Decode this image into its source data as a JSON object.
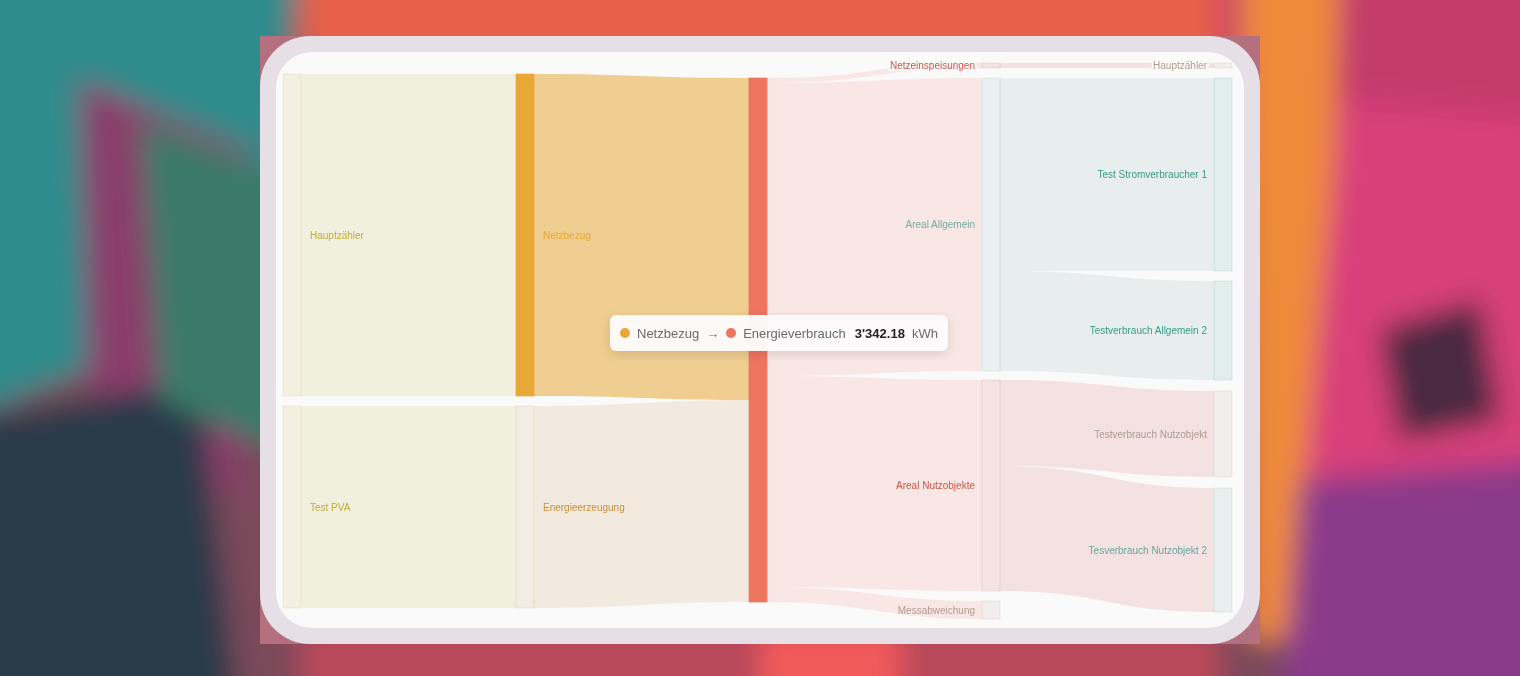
{
  "sankey": {
    "columns": [
      {
        "nodes": [
          {
            "label": "Hauptzähler",
            "color": "#c2ae3c",
            "highlighted": false
          },
          {
            "label": "Test PVA",
            "color": "#c2ae3c",
            "highlighted": false
          }
        ]
      },
      {
        "nodes": [
          {
            "label": "Netzbezug",
            "color": "#e8a838",
            "highlighted": true
          },
          {
            "label": "Energieerzeugung",
            "color": "#c98f36",
            "highlighted": false
          }
        ]
      },
      {
        "nodes": [
          {
            "color": "#f07560",
            "highlighted": true
          }
        ]
      },
      {
        "nodes": [
          {
            "label": "Netzeinspeisungen",
            "color": "#cc564b",
            "highlighted": false
          },
          {
            "label": "Areal Allgemein",
            "color": "#78aaa2",
            "highlighted": false
          },
          {
            "label": "Areal Nutzobjekte",
            "color": "#cc564b",
            "highlighted": false
          },
          {
            "label": "Messabweichung",
            "color": "#b39b90",
            "highlighted": false
          }
        ]
      },
      {
        "nodes": [
          {
            "label": "Hauptzähler",
            "color": "#b39b90",
            "highlighted": false
          },
          {
            "label": "Test Stromverbraucher 1",
            "color": "#3a9a88",
            "highlighted": false
          },
          {
            "label": "Testverbrauch Allgemein 2",
            "color": "#3a9a88",
            "highlighted": false
          },
          {
            "label": "Testverbrauch Nutzobjekt",
            "color": "#b39b90",
            "highlighted": false
          },
          {
            "label": "Tesverbrauch Nutzobjekt 2",
            "color": "#6aa69c",
            "highlighted": false
          }
        ]
      }
    ],
    "links": [
      {
        "highlighted": false
      },
      {
        "highlighted": false
      },
      {
        "highlighted": true
      },
      {
        "highlighted": false
      },
      {
        "highlighted": false
      },
      {
        "highlighted": false
      },
      {
        "highlighted": false
      },
      {
        "highlighted": false
      },
      {
        "highlighted": false
      },
      {
        "highlighted": false
      },
      {
        "highlighted": false
      },
      {
        "highlighted": false
      },
      {
        "highlighted": false
      }
    ]
  },
  "tooltip": {
    "source": {
      "label": "Netzbezug",
      "color": "#e8a838"
    },
    "arrow": "→",
    "target": {
      "label": "Energieverbrauch",
      "color": "#f07560"
    },
    "value": "3'342.18",
    "unit": "kWh"
  }
}
